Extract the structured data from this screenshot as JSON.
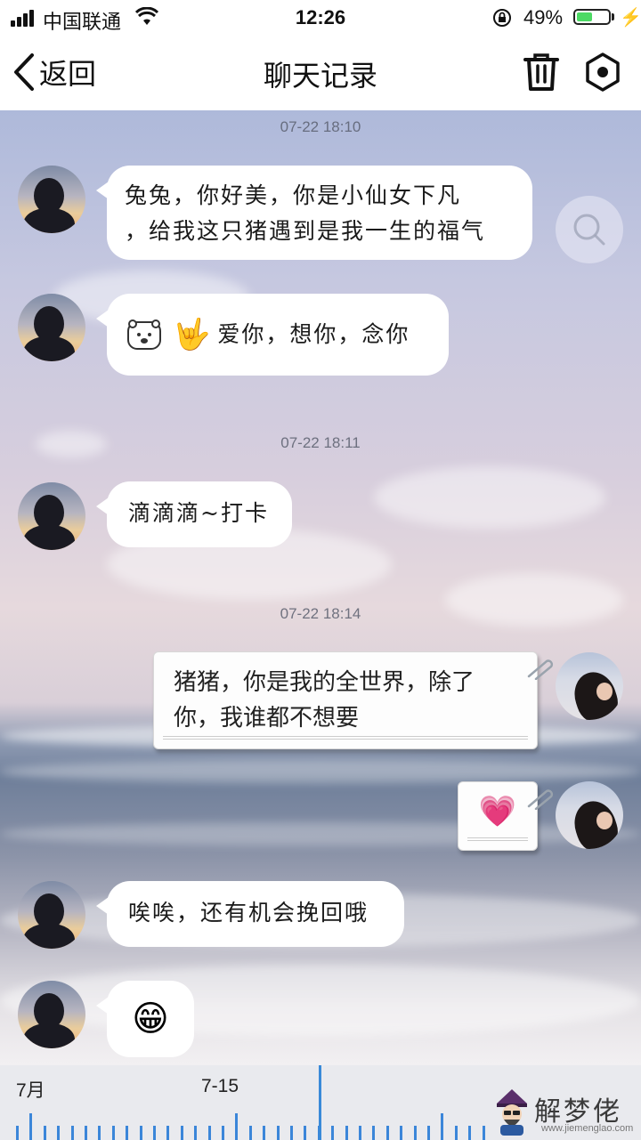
{
  "status_bar": {
    "carrier": "中国联通",
    "time": "12:26",
    "battery": "49%",
    "battery_level": 0.49
  },
  "nav": {
    "back_label": "返回",
    "title": "聊天记录"
  },
  "timestamps": [
    "07-22 18:10",
    "07-22 18:11",
    "07-22 18:14"
  ],
  "messages": [
    {
      "side": "left",
      "text_line1": "兔兔，你好美，你是小仙女下凡",
      "text_line2": "，给我这只猪遇到是我一生的福气"
    },
    {
      "side": "left",
      "text": "爱你，想你，念你"
    },
    {
      "side": "left",
      "text": "滴滴滴~打卡"
    },
    {
      "side": "right",
      "text_line1": "猪猪，你是我的全世界，除了",
      "text_line2": "你，我谁都不想要"
    },
    {
      "side": "right",
      "emoji": "💗"
    },
    {
      "side": "left",
      "text": "唉唉，还有机会挽回哦"
    },
    {
      "side": "left",
      "emoji": "😁"
    }
  ],
  "timeline": {
    "month_label": "7月",
    "date_label": "7-15"
  },
  "watermark": {
    "text": "解梦佬",
    "url": "www.jiemenglao.com"
  },
  "colors": {
    "accent": "#3b86d9",
    "battery": "#4cd964"
  }
}
